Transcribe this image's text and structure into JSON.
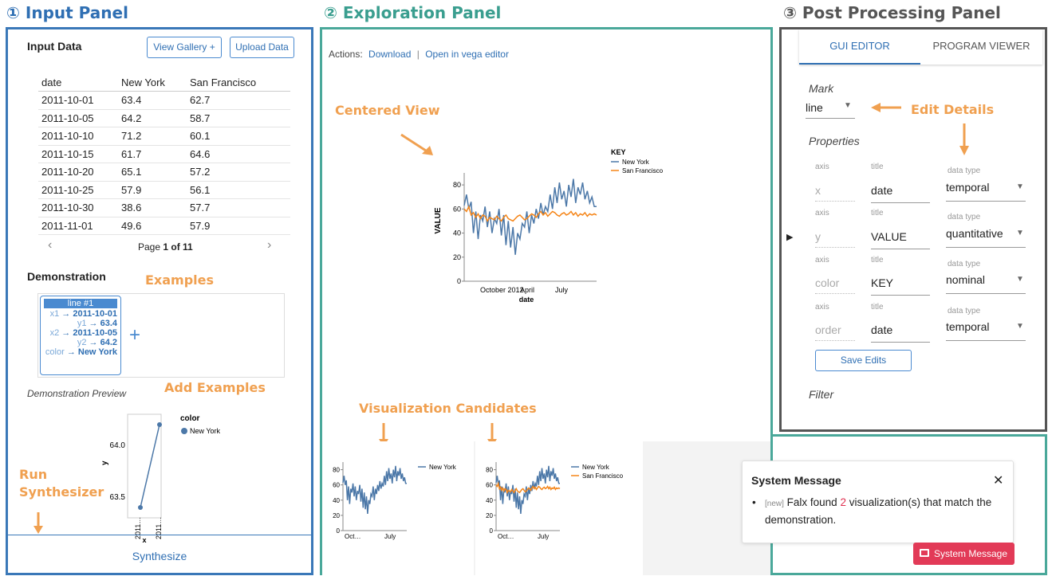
{
  "panels": {
    "input_title": "① Input Panel",
    "explore_title": "② Exploration Panel",
    "post_title": "③ Post Processing Panel"
  },
  "input": {
    "heading": "Input Data",
    "view_gallery": "View Gallery +",
    "upload_data": "Upload Data",
    "table": {
      "columns": [
        "date",
        "New York",
        "San Francisco"
      ],
      "rows": [
        [
          "2011-10-01",
          "63.4",
          "62.7"
        ],
        [
          "2011-10-05",
          "64.2",
          "58.7"
        ],
        [
          "2011-10-10",
          "71.2",
          "60.1"
        ],
        [
          "2011-10-15",
          "61.7",
          "64.6"
        ],
        [
          "2011-10-20",
          "65.1",
          "57.2"
        ],
        [
          "2011-10-25",
          "57.9",
          "56.1"
        ],
        [
          "2011-10-30",
          "38.6",
          "57.7"
        ],
        [
          "2011-11-01",
          "49.6",
          "57.9"
        ]
      ]
    },
    "pager": {
      "prefix": "Page ",
      "current": "1",
      "mid": " of ",
      "total": "11"
    },
    "demonstration": "Demonstration",
    "examples_note": "Examples",
    "demo_card": {
      "head": "line #1",
      "lines": [
        {
          "key": "x1",
          "value": "2011-10-01"
        },
        {
          "key": "y1",
          "value": "63.4"
        },
        {
          "key": "x2",
          "value": "2011-10-05"
        },
        {
          "key": "y2",
          "value": "64.2"
        },
        {
          "key": "color",
          "value": "New York"
        }
      ],
      "arrow": "→"
    },
    "add_symbol": "+",
    "add_examples_note": "Add Examples",
    "preview_label": "Demonstration Preview",
    "preview_legend_title": "color",
    "preview_legend_item": "New York",
    "run_note_1": "Run",
    "run_note_2": "Synthesizer",
    "synthesize": "Synthesize"
  },
  "explore": {
    "actions_label": "Actions:",
    "download": "Download",
    "separator": "|",
    "open_vega": "Open in vega editor",
    "centered_note": "Centered View",
    "candidates_note": "Visualization Candidates",
    "system": {
      "title": "System Message",
      "close": "✕",
      "new_tag": "[new]",
      "msg_pre": " Falx found ",
      "count": "2",
      "msg_post": " visualization(s) that match the demonstration.",
      "button": "System Message"
    },
    "colors": {
      "ny": "#4c78a8",
      "sf": "#f58518"
    }
  },
  "post": {
    "tabs": [
      "GUI EDITOR",
      "PROGRAM VIEWER"
    ],
    "mark_label": "Mark",
    "mark_value": "line",
    "edit_note": "Edit Details",
    "properties": "Properties",
    "rows": [
      {
        "axis": "x",
        "title": "date",
        "type": "temporal"
      },
      {
        "axis": "y",
        "title": "VALUE",
        "type": "quantitative"
      },
      {
        "axis": "color",
        "title": "KEY",
        "type": "nominal"
      },
      {
        "axis": "order",
        "title": "date",
        "type": "temporal"
      }
    ],
    "axis_lbl": "axis",
    "title_lbl": "title",
    "type_lbl": "data type",
    "save": "Save Edits",
    "filter": "Filter"
  },
  "chart_data": [
    {
      "type": "line",
      "role": "centered view",
      "x_ticks": [
        "October 2012",
        "April",
        "July"
      ],
      "xlabel": "date",
      "ylabel": "VALUE",
      "ylim": [
        0,
        90
      ],
      "y_ticks": [
        0,
        20,
        40,
        60,
        80
      ],
      "legend_title": "KEY",
      "legend_position": "right",
      "series": [
        {
          "name": "New York",
          "values": [
            63,
            72,
            60,
            66,
            40,
            58,
            35,
            55,
            50,
            62,
            45,
            58,
            40,
            52,
            48,
            60,
            38,
            55,
            30,
            50,
            28,
            45,
            22,
            40,
            35,
            48,
            45,
            58,
            40,
            55,
            48,
            60,
            52,
            65,
            55,
            62,
            58,
            72,
            60,
            78,
            65,
            82,
            68,
            75,
            62,
            80,
            70,
            85,
            65,
            78,
            72,
            82,
            68,
            75,
            65,
            70,
            62,
            62
          ]
        },
        {
          "name": "San Francisco",
          "values": [
            60,
            58,
            62,
            55,
            57,
            53,
            56,
            52,
            55,
            54,
            50,
            53,
            52,
            51,
            54,
            52,
            50,
            53,
            55,
            52,
            51,
            50,
            52,
            54,
            55,
            53,
            51,
            52,
            54,
            56,
            55,
            53,
            56,
            58,
            55,
            57,
            54,
            56,
            58,
            57,
            55,
            54,
            56,
            57,
            55,
            56,
            58,
            55,
            57,
            54,
            56,
            55,
            57,
            54,
            56,
            55,
            56,
            55
          ]
        }
      ]
    },
    {
      "type": "line",
      "role": "candidate 1",
      "x_ticks": [
        "Oct…",
        "July"
      ],
      "ylim": [
        0,
        90
      ],
      "y_ticks": [
        0,
        20,
        40,
        60,
        80
      ],
      "series": [
        {
          "name": "New York",
          "values": [
            63,
            72,
            60,
            66,
            40,
            58,
            35,
            55,
            50,
            62,
            45,
            58,
            40,
            52,
            48,
            60,
            38,
            55,
            30,
            50,
            28,
            45,
            22,
            40,
            35,
            48,
            45,
            58,
            40,
            55,
            48,
            60,
            52,
            65,
            55,
            62,
            58,
            72,
            60,
            78,
            65,
            82,
            68,
            75,
            62,
            80,
            70,
            85,
            65,
            78,
            72,
            82,
            68,
            75,
            65,
            70,
            62,
            62
          ]
        }
      ]
    },
    {
      "type": "line",
      "role": "candidate 2",
      "x_ticks": [
        "Oct…",
        "July"
      ],
      "ylim": [
        0,
        90
      ],
      "y_ticks": [
        0,
        20,
        40,
        60,
        80
      ],
      "series": [
        {
          "name": "New York",
          "values": [
            63,
            72,
            60,
            66,
            40,
            58,
            35,
            55,
            50,
            62,
            45,
            58,
            40,
            52,
            48,
            60,
            38,
            55,
            30,
            50,
            28,
            45,
            22,
            40,
            35,
            48,
            45,
            58,
            40,
            55,
            48,
            60,
            52,
            65,
            55,
            62,
            58,
            72,
            60,
            78,
            65,
            82,
            68,
            75,
            62,
            80,
            70,
            85,
            65,
            78,
            72,
            82,
            68,
            75,
            65,
            70,
            62,
            62
          ]
        },
        {
          "name": "San Francisco",
          "values": [
            60,
            58,
            62,
            55,
            57,
            53,
            56,
            52,
            55,
            54,
            50,
            53,
            52,
            51,
            54,
            52,
            50,
            53,
            55,
            52,
            51,
            50,
            52,
            54,
            55,
            53,
            51,
            52,
            54,
            56,
            55,
            53,
            56,
            58,
            55,
            57,
            54,
            56,
            58,
            57,
            55,
            54,
            56,
            57,
            55,
            56,
            58,
            55,
            57,
            54,
            56,
            55,
            57,
            54,
            56,
            55,
            56,
            55
          ]
        }
      ]
    },
    {
      "type": "scatter",
      "role": "demonstration preview",
      "x": [
        "2011-10-01",
        "2011-10-05"
      ],
      "x_tick_labels": [
        "2011…",
        "2011…"
      ],
      "xlabel": "x",
      "ylabel": "y",
      "y_ticks": [
        63.5,
        64.0
      ],
      "ylim": [
        63.3,
        64.3
      ],
      "series": [
        {
          "name": "New York",
          "values": [
            63.4,
            64.2
          ]
        }
      ]
    }
  ]
}
